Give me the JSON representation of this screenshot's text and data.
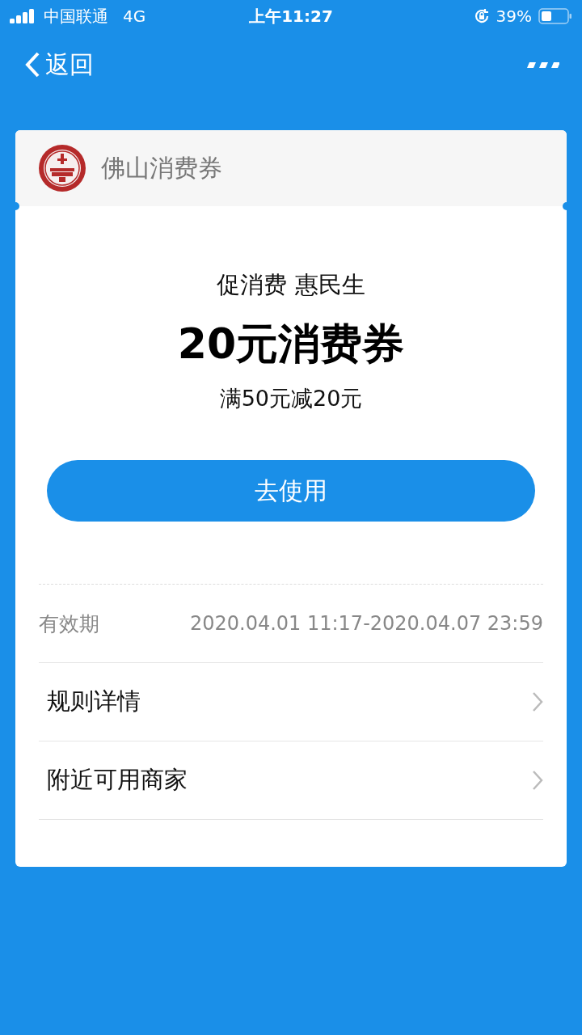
{
  "status_bar": {
    "carrier": "中国联通",
    "network": "4G",
    "time": "上午11:27",
    "battery": "39%"
  },
  "nav": {
    "back": "返回"
  },
  "card": {
    "issuer": "佛山消费券",
    "slogan": "促消费 惠民生",
    "title": "20元消费券",
    "condition": "满50元减20元",
    "button": "去使用",
    "validity": {
      "label": "有效期",
      "value": "2020.04.01 11:17-2020.04.07 23:59"
    },
    "links": [
      {
        "label": "规则详情"
      },
      {
        "label": "附近可用商家"
      }
    ]
  }
}
